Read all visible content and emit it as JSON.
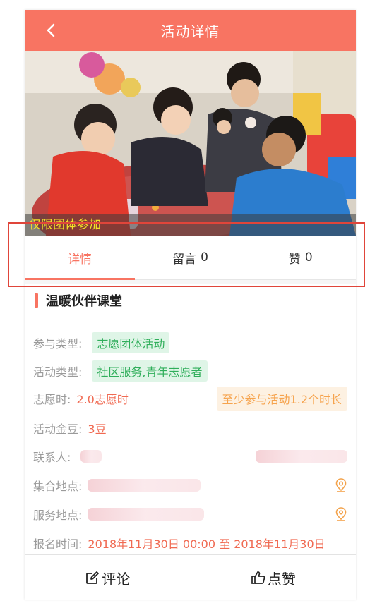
{
  "header": {
    "title": "活动详情",
    "back_icon": "chevron-left-icon"
  },
  "banner": {
    "restriction": "仅限团体参加"
  },
  "tabs": [
    {
      "label": "详情",
      "count": ""
    },
    {
      "label": "留言",
      "count": "0"
    },
    {
      "label": "赞",
      "count": "0"
    }
  ],
  "activity": {
    "name": "温暖伙伴课堂",
    "participation_type_label": "参与类型:",
    "participation_type": "志愿团体活动",
    "activity_type_label": "活动类型:",
    "activity_type": "社区服务,青年志愿者",
    "hours_label": "志愿时:",
    "hours": "2.0志愿时",
    "min_duration": "至少参与活动1.2个时长",
    "beans_label": "活动金豆:",
    "beans": "3豆",
    "contact_label": "联系人:",
    "gather_label": "集合地点:",
    "service_label": "服务地点:",
    "signup_label": "报名时间:",
    "signup_time": "2018年11月30日 00:00 至 2018年11月30日"
  },
  "footer": {
    "comment": "评论",
    "like": "点赞",
    "comment_icon": "edit-icon",
    "like_icon": "thumbs-up-icon"
  },
  "colors": {
    "accent": "#f87462",
    "tag_green_bg": "#dff5e7",
    "tag_green_text": "#2fae5a",
    "tag_orange_bg": "#fdf1e2",
    "tag_orange_text": "#f6a34d"
  }
}
